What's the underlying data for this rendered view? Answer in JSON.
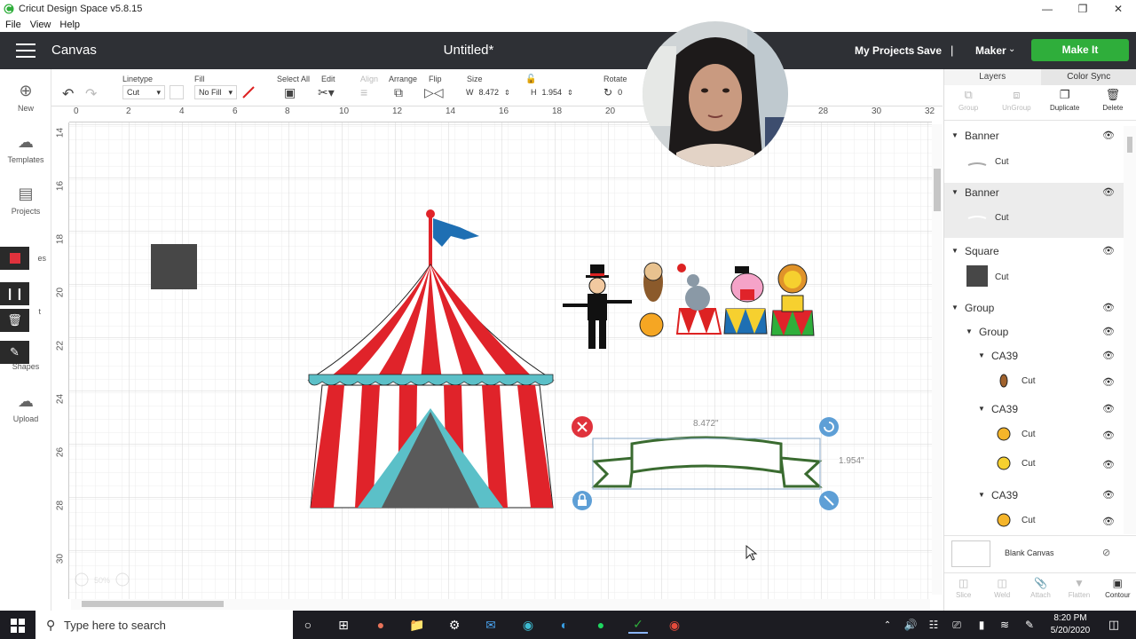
{
  "window": {
    "title": "Cricut Design Space  v5.8.15",
    "menu": [
      "File",
      "View",
      "Help"
    ]
  },
  "header": {
    "section": "Canvas",
    "doc_title": "Untitled*",
    "my_projects": "My Projects",
    "save": "Save",
    "separator": "|",
    "machine": "Maker",
    "make_it": "Make It",
    "brand_color": "#2fae3b"
  },
  "toolbar": {
    "linetype_label": "Linetype",
    "linetype_value": "Cut",
    "fill_label": "Fill",
    "fill_value": "No Fill",
    "select_all_label": "Select All",
    "edit_label": "Edit",
    "align_label": "Align",
    "arrange_label": "Arrange",
    "flip_label": "Flip",
    "size_label": "Size",
    "w_label": "W",
    "w_value": "8.472",
    "h_label": "H",
    "h_value": "1.954",
    "rotate_label": "Rotate",
    "rotate_value": "0"
  },
  "leftbar": {
    "new": "New",
    "templates": "Templates",
    "projects": "Projects",
    "images_partial": "es",
    "text_partial": "t",
    "shapes": "Shapes",
    "upload": "Upload"
  },
  "rulers": {
    "top": [
      "0",
      "2",
      "4",
      "6",
      "8",
      "10",
      "12",
      "14",
      "16",
      "18",
      "20",
      "28",
      "30",
      "32"
    ],
    "left": [
      "14",
      "16",
      "18",
      "20",
      "22",
      "24",
      "26",
      "28",
      "30"
    ]
  },
  "selection": {
    "width_label": "8.472\"",
    "height_label": "1.954\""
  },
  "zoom": "50%",
  "layers_panel": {
    "tab_layers": "Layers",
    "tab_color_sync": "Color Sync",
    "action_group": "Group",
    "action_ungroup": "UnGroup",
    "action_duplicate": "Duplicate",
    "action_delete": "Delete",
    "items": [
      {
        "name": "Banner",
        "op": "Cut"
      },
      {
        "name": "Banner",
        "op": "Cut"
      },
      {
        "name": "Square",
        "op": "Cut"
      },
      {
        "name": "Group"
      },
      {
        "name": "Group"
      },
      {
        "name": "CA39",
        "op": "Cut"
      },
      {
        "name": "CA39",
        "op": "Cut",
        "op2": "Cut"
      },
      {
        "name": "CA39",
        "op": "Cut"
      }
    ],
    "blank_canvas": "Blank Canvas",
    "bottom_actions": [
      "Slice",
      "Weld",
      "Attach",
      "Flatten",
      "Contour"
    ]
  },
  "taskbar": {
    "search_placeholder": "Type here to search",
    "time": "8:20 PM",
    "date": "5/20/2020"
  }
}
